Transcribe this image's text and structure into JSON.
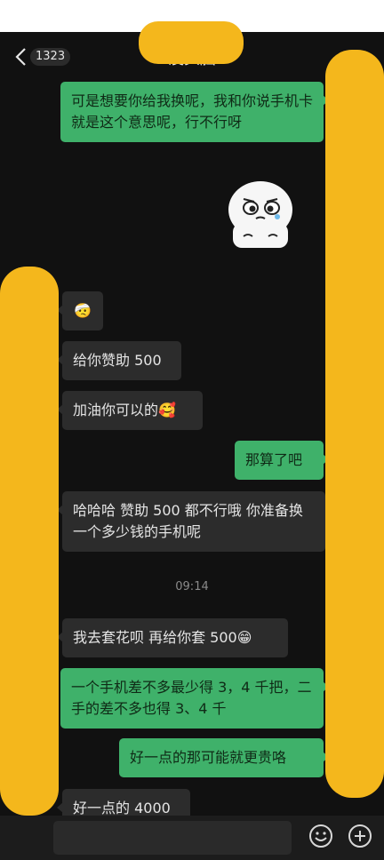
{
  "header": {
    "unread_count": "1323",
    "title": "没头脑"
  },
  "messages": [
    {
      "side": "me",
      "text": "可是想要你给我换呢，我和你说手机卡就是这个意思呢，行不行呀"
    },
    {
      "side": "them",
      "text": "🤕"
    },
    {
      "side": "them",
      "text": "给你赞助 500"
    },
    {
      "side": "them",
      "text": "加油你可以的🥰"
    },
    {
      "side": "me",
      "text": "那算了吧"
    },
    {
      "side": "them",
      "text": "哈哈哈 赞助 500 都不行哦 你准备换一个多少钱的手机呢"
    },
    {
      "side": "them",
      "text": "我去套花呗 再给你套 500😁"
    },
    {
      "side": "me",
      "text": "一个手机差不多最少得 3，4 千把，二手的差不多也得 3、4 千"
    },
    {
      "side": "me",
      "text": "好一点的那可能就更贵咯"
    },
    {
      "side": "them",
      "text": "好一点的 4000"
    }
  ],
  "timestamp": "09:14",
  "colors": {
    "my_bubble": "#3fb16a",
    "their_bubble": "#2c2c2c",
    "redaction": "#f4b71c"
  },
  "icons": [
    "back-chevron-icon",
    "sticker-icon",
    "emoji-icon",
    "plus-icon"
  ]
}
